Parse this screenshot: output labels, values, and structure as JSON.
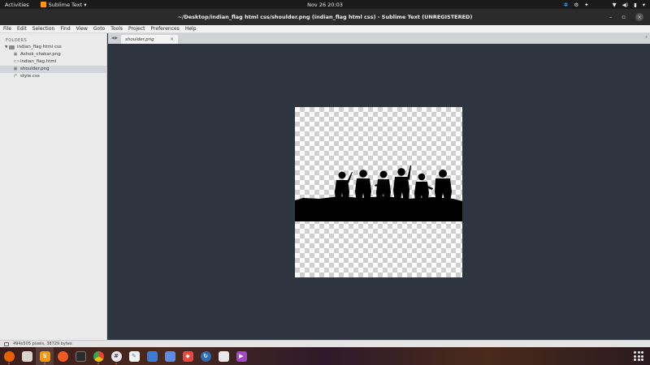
{
  "topbar": {
    "activities": "Activities",
    "app_name": "Sublime Text ▾",
    "clock": "Nov 26  20:03"
  },
  "window": {
    "title": "~/Desktop/indian_flag html css/shoulder.png (indian_flag html css) - Sublime Text (UNREGISTERED)"
  },
  "menu": {
    "items": [
      "File",
      "Edit",
      "Selection",
      "Find",
      "View",
      "Goto",
      "Tools",
      "Project",
      "Preferences",
      "Help"
    ]
  },
  "sidebar": {
    "heading": "FOLDERS",
    "folder": "indian_flag html css",
    "files": [
      {
        "name": "Ashok_chakar.png",
        "icon": "image-file-icon"
      },
      {
        "name": "indian_flag.html",
        "icon": "code-file-icon"
      },
      {
        "name": "shoulder.png",
        "icon": "image-file-icon",
        "selected": true
      },
      {
        "name": "style.css",
        "icon": "css-file-icon"
      }
    ]
  },
  "tabs": [
    {
      "label": "shoulder.png",
      "close": "×"
    }
  ],
  "statusbar": {
    "text": "494x505 pixels, 38729 bytes"
  },
  "dock": {
    "apps": [
      {
        "name": "firefox-icon",
        "color": "#e66000"
      },
      {
        "name": "files-icon",
        "color": "#d9d4cc"
      },
      {
        "name": "sublime-text-icon",
        "color": "#4b4b4b"
      },
      {
        "name": "postman-icon",
        "color": "#ef5b25"
      },
      {
        "name": "terminal-icon",
        "color": "#2c2c2c"
      },
      {
        "name": "chrome-icon",
        "color": "#4285f4"
      },
      {
        "name": "slack-icon",
        "color": "#e8e8e8"
      },
      {
        "name": "text-editor-icon",
        "color": "#f2f2f2"
      },
      {
        "name": "screenshot-icon",
        "color": "#3a7bd5"
      },
      {
        "name": "dock-app-icon",
        "color": "#5b8de8"
      },
      {
        "name": "anydesk-icon",
        "color": "#ef443b"
      },
      {
        "name": "timeshift-icon",
        "color": "#2d6cb5"
      },
      {
        "name": "document-viewer-icon",
        "color": "#e8e8e8"
      },
      {
        "name": "video-player-icon",
        "color": "#a349c8"
      }
    ]
  }
}
